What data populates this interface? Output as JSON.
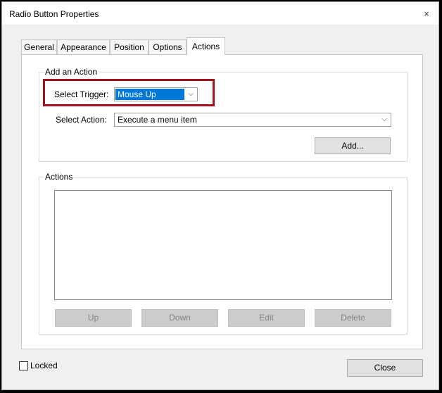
{
  "window": {
    "title": "Radio Button Properties",
    "close_glyph": "×"
  },
  "tabs": [
    {
      "label": "General"
    },
    {
      "label": "Appearance"
    },
    {
      "label": "Position"
    },
    {
      "label": "Options"
    },
    {
      "label": "Actions",
      "active": true
    }
  ],
  "add_action": {
    "group_label": "Add an Action",
    "trigger_label": "Select Trigger:",
    "trigger_value": "Mouse Up",
    "action_label": "Select Action:",
    "action_value": "Execute a menu item",
    "add_button": "Add..."
  },
  "actions": {
    "group_label": "Actions",
    "items": [],
    "buttons": {
      "up": "Up",
      "down": "Down",
      "edit": "Edit",
      "delete": "Delete"
    }
  },
  "footer": {
    "locked_label": "Locked",
    "locked_checked": false,
    "close_button": "Close"
  },
  "colors": {
    "highlight": "#a0121c",
    "selection": "#0078d7"
  },
  "icons": {
    "close": "close-icon",
    "dropdown": "chevron-down-icon"
  }
}
